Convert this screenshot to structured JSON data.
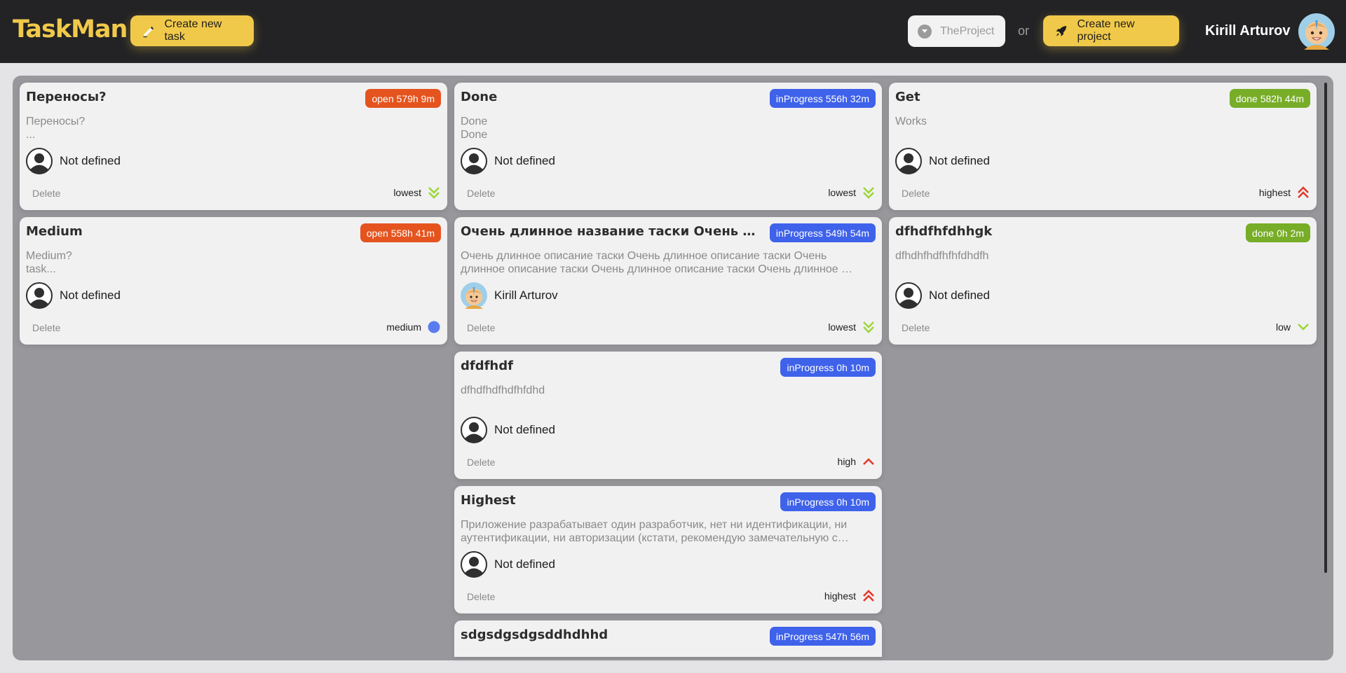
{
  "app": {
    "logo": "TaskMan",
    "create_task_label": "Create new task",
    "project_select_value": "TheProject",
    "or_label": "or",
    "create_project_label": "Create new project",
    "user_name": "Kirill Arturov"
  },
  "colors": {
    "accent": "#f1c94a",
    "header_bg": "#232325",
    "board_bg": "#98989c",
    "status_open": "#e5541f",
    "status_inProgress": "#3f62ea",
    "status_done": "#77ad27"
  },
  "delete_label": "Delete",
  "columns": [
    {
      "cards": [
        {
          "title": "Переносы?",
          "status": "open 579h 9m",
          "status_type": "open",
          "desc": [
            "Переносы?",
            "..."
          ],
          "assignee": "Not defined",
          "assignee_avatar": "default-user-icon",
          "priority": "lowest",
          "priority_icon": "double-chevron-down-icon"
        },
        {
          "title": "Medium",
          "status": "open 558h 41m",
          "status_type": "open",
          "desc": [
            "Medium?",
            "task..."
          ],
          "assignee": "Not defined",
          "assignee_avatar": "default-user-icon",
          "priority": "medium",
          "priority_icon": "dot-icon"
        }
      ]
    },
    {
      "cards": [
        {
          "title": "Done",
          "status": "inProgress 556h 32m",
          "status_type": "inProgress",
          "desc": [
            "Done",
            "Done"
          ],
          "assignee": "Not defined",
          "assignee_avatar": "default-user-icon",
          "priority": "lowest",
          "priority_icon": "double-chevron-down-icon"
        },
        {
          "title": "Очень длинное название таски Очень длинное название таски",
          "status": "inProgress 549h 54m",
          "status_type": "inProgress",
          "desc": [
            "Очень длинное описание таски Очень длинное описание таски Очень",
            "длинное описание таски Очень длинное описание таски Очень длинное описание таски"
          ],
          "assignee": "Kirill Arturov",
          "assignee_avatar": "user-photo-avatar",
          "priority": "lowest",
          "priority_icon": "double-chevron-down-icon"
        },
        {
          "title": "dfdfhdf",
          "status": "inProgress 0h 10m",
          "status_type": "inProgress",
          "desc": [
            "dfhdfhdfhdfhfdhd"
          ],
          "assignee": "Not defined",
          "assignee_avatar": "default-user-icon",
          "priority": "high",
          "priority_icon": "chevron-up-icon"
        },
        {
          "title": "Highest",
          "status": "inProgress 0h 10m",
          "status_type": "inProgress",
          "desc": [
            "Приложение разрабатывает один разработчик, нет ни идентификации, ни",
            "аутентификации, ни авторизации (кстати, рекомендую замечательную статью на эту тему)"
          ],
          "assignee": "Not defined",
          "assignee_avatar": "default-user-icon",
          "priority": "highest",
          "priority_icon": "double-chevron-up-icon"
        },
        {
          "title": "sdgsdgsdgsddhdhhd",
          "status": "inProgress 547h 56m",
          "status_type": "inProgress",
          "desc": [],
          "assignee": "",
          "assignee_avatar": "",
          "priority": "",
          "priority_icon": ""
        }
      ]
    },
    {
      "cards": [
        {
          "title": "Get",
          "status": "done 582h 44m",
          "status_type": "done",
          "desc": [
            "Works"
          ],
          "assignee": "Not defined",
          "assignee_avatar": "default-user-icon",
          "priority": "highest",
          "priority_icon": "double-chevron-up-icon"
        },
        {
          "title": "dfhdfhfdhhgk",
          "status": "done 0h 2m",
          "status_type": "done",
          "desc": [
            "dfhdhfhdfhfhfdhdfh"
          ],
          "assignee": "Not defined",
          "assignee_avatar": "default-user-icon",
          "priority": "low",
          "priority_icon": "chevron-down-icon"
        }
      ]
    }
  ]
}
